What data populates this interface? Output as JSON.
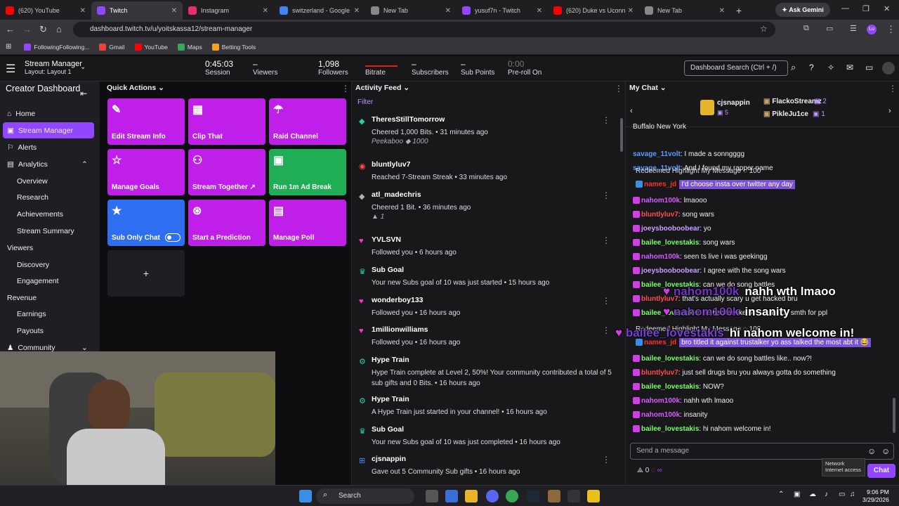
{
  "browser": {
    "tabs": [
      {
        "title": "(620) YouTube",
        "color": "#ff0000"
      },
      {
        "title": "Twitch",
        "color": "#9147ff"
      },
      {
        "title": "Instagram",
        "color": "#e1306c"
      },
      {
        "title": "switzerland - Google Se",
        "color": "#4285f4"
      },
      {
        "title": "New Tab",
        "color": "#888888"
      },
      {
        "title": "yusuf7n - Twitch",
        "color": "#9147ff"
      },
      {
        "title": "(620) Duke vs Uconn -",
        "color": "#ff0000"
      },
      {
        "title": "New Tab",
        "color": "#888888"
      }
    ],
    "gemini_label": "Ask Gemini",
    "url": "dashboard.twitch.tv/u/yoitskassa12/stream-manager",
    "bookmarks": [
      "FollowingFollowing...",
      "Gmail",
      "YouTube",
      "Maps",
      "Betting Tools"
    ]
  },
  "header": {
    "title": "Stream Manager",
    "layout": "Layout: Layout 1",
    "stats": [
      {
        "value": "0:45:03",
        "label": "Session"
      },
      {
        "value": "–",
        "label": "Viewers"
      },
      {
        "value": "1,098",
        "label": "Followers"
      },
      {
        "value": "",
        "label": "Bitrate"
      },
      {
        "value": "–",
        "label": "Subscribers"
      },
      {
        "value": "–",
        "label": "Sub Points"
      },
      {
        "value": "0:00",
        "label": "Pre-roll On"
      }
    ],
    "search_placeholder": "Dashboard Search (Ctrl + /)"
  },
  "sidebar": {
    "title": "Creator Dashboard",
    "items": [
      "Home",
      "Stream Manager",
      "Alerts",
      "Analytics",
      "Overview",
      "Research",
      "Achievements",
      "Stream Summary",
      "Viewers",
      "Discovery",
      "Engagement",
      "Revenue",
      "Earnings",
      "Payouts",
      "Community"
    ]
  },
  "quick_actions": {
    "title": "Quick Actions",
    "buttons": [
      {
        "label": "Edit Stream Info",
        "icon": "✎",
        "color": "#bf1fe8"
      },
      {
        "label": "Clip That",
        "icon": "▦",
        "color": "#bf1fe8"
      },
      {
        "label": "Raid Channel",
        "icon": "☂",
        "color": "#bf1fe8"
      },
      {
        "label": "Manage Goals",
        "icon": "☆",
        "color": "#bf1fe8"
      },
      {
        "label": "Stream Together ↗",
        "icon": "⚇",
        "color": "#bf1fe8"
      },
      {
        "label": "Run 1m Ad Break",
        "icon": "▣",
        "color": "#1fae56"
      },
      {
        "label": "Sub Only Chat",
        "icon": "★",
        "color": "#2e6ff2"
      },
      {
        "label": "Start a Prediction",
        "icon": "⊛",
        "color": "#bf1fe8"
      },
      {
        "label": "Manage Poll",
        "icon": "▤",
        "color": "#bf1fe8"
      }
    ],
    "add_label": "+"
  },
  "activity": {
    "title": "Activity Feed",
    "filter": "Filter",
    "items": [
      {
        "icon": "◆",
        "color": "#2ad1a0",
        "name": "TheresStillTomorrow",
        "desc": "Cheered 1,000 Bits. • 31 minutes ago",
        "extra": "Peekaboo ◆ 1000"
      },
      {
        "icon": "◉",
        "color": "#ff4d4d",
        "name": "bluntlyluv7",
        "desc": "Reached 7-Stream Streak • 33 minutes ago"
      },
      {
        "icon": "◆",
        "color": "#b0b0b0",
        "name": "atl_madechris",
        "desc": "Cheered 1 Bit. • 36 minutes ago",
        "extra": "▲ 1"
      },
      {
        "icon": "♥",
        "color": "#ff33cc",
        "name": "YVLSVN",
        "desc": "Followed you • 6 hours ago"
      },
      {
        "icon": "♛",
        "color": "#2ad1a0",
        "name": "Sub Goal",
        "desc": "Your new Subs goal of 10 was just started • 15 hours ago"
      },
      {
        "icon": "♥",
        "color": "#ff33cc",
        "name": "wonderboy133",
        "desc": "Followed you • 16 hours ago"
      },
      {
        "icon": "♥",
        "color": "#ff33cc",
        "name": "1millionwilliams",
        "desc": "Followed you • 16 hours ago"
      },
      {
        "icon": "⚙",
        "color": "#2ad1a0",
        "name": "Hype Train",
        "desc": "Hype Train complete at Level 2, 50%! Your community contributed a total of 5 sub gifts and 0 Bits. • 16 hours ago"
      },
      {
        "icon": "⚙",
        "color": "#2ad1a0",
        "name": "Hype Train",
        "desc": "A Hype Train just started in your channel! • 16 hours ago"
      },
      {
        "icon": "♛",
        "color": "#2ad1a0",
        "name": "Sub Goal",
        "desc": "Your new Subs goal of 10 was just completed • 16 hours ago"
      },
      {
        "icon": "⊞",
        "color": "#4d8cff",
        "name": "cjsnappin",
        "desc": "Gave out 5 Community Sub gifts • 16 hours ago"
      }
    ]
  },
  "chat": {
    "title": "My Chat",
    "leaderboard": {
      "top": "cjsnappin",
      "top_count": "5",
      "second": "FlackoStreamz",
      "second_count": "2",
      "third": "PikleJu1ce",
      "third_count": "1"
    },
    "lines": [
      {
        "user": "",
        "color": "#efeff1",
        "text": "Buffalo New York"
      },
      {
        "user": "savage_11volt",
        "color": "#5c9dff",
        "text": ": I made a sonngggg"
      },
      {
        "user": "savage_11volt",
        "color": "#5c9dff",
        "text": ": And I found my rapper name"
      },
      {
        "user": "",
        "color": "#dedee3",
        "text": "Redeemed Highlight My Message  ◌ 100"
      },
      {
        "user": "names_jd",
        "color": "#ff2e2e",
        "text": "I'd choose insta over twitter any day"
      },
      {
        "user": "nahom100k",
        "color": "#d65cff",
        "text": ": lmaooo"
      },
      {
        "user": "bluntlyluv7",
        "color": "#ff4d4d",
        "text": ": song wars"
      },
      {
        "user": "joeysbooboobear",
        "color": "#c7a0ff",
        "text": ": yo"
      },
      {
        "user": "bailee_lovestakis",
        "color": "#7cfc6a",
        "text": ": song wars"
      },
      {
        "user": "nahom100k",
        "color": "#d65cff",
        "text": ": seen ts live i was geekingg"
      },
      {
        "user": "joeysbooboobear",
        "color": "#c7a0ff",
        "text": ": I agree with the song wars"
      },
      {
        "user": "bailee_lovestakis",
        "color": "#7cfc6a",
        "text": ": can we do song battles"
      },
      {
        "user": "bluntlyluv7",
        "color": "#ff4d4d",
        "text": ": that's actually scary u get hacked bru"
      },
      {
        "user": "bailee_lovestakis",
        "color": "#7cfc6a",
        "text": ": he hacker like bs... gotta do smth for ppl"
      },
      {
        "user": "",
        "color": "#dedee3",
        "text": "Redeemed Highlight My Message  ◌ 100"
      },
      {
        "user": "names_jd",
        "color": "#ff2e2e",
        "text": "bro titled it against trustalker yo ass talked the most abt it 😂"
      },
      {
        "user": "bailee_lovestakis",
        "color": "#7cfc6a",
        "text": ": can we do song battles like.. now?!"
      },
      {
        "user": "bluntlyluv7",
        "color": "#ff4d4d",
        "text": ": just sell drugs bru you always gotta do something"
      },
      {
        "user": "bailee_lovestakis",
        "color": "#7cfc6a",
        "text": ": NOW?"
      },
      {
        "user": "nahom100k",
        "color": "#d65cff",
        "text": ": nahh wth lmaoo"
      },
      {
        "user": "nahom100k",
        "color": "#d65cff",
        "text": ": insanity"
      },
      {
        "user": "bailee_lovestakis",
        "color": "#7cfc6a",
        "text": ": hi nahom welcome in!"
      }
    ],
    "overlay": [
      {
        "user": "nahom100k",
        "text": "nahh wth lmaoo"
      },
      {
        "user": "nahom100k",
        "text": "insanity"
      },
      {
        "user": "bailee_lovestakis",
        "text": "hi nahom welcome in!"
      }
    ],
    "input_placeholder": "Send a message",
    "points": "0",
    "send_label": "Chat"
  },
  "taskbar": {
    "search": "Search",
    "time": "9:06 PM",
    "date": "3/29/2026",
    "tooltip_title": "Network",
    "tooltip_text": "Internet access"
  }
}
